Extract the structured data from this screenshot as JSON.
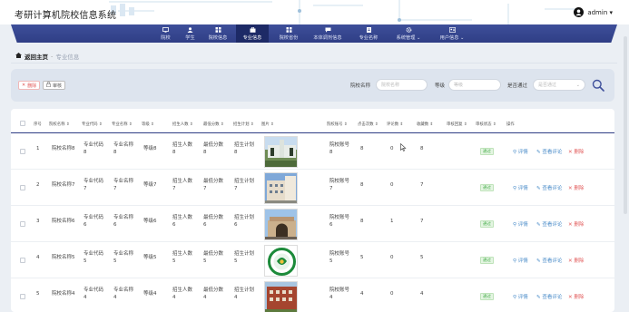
{
  "header": {
    "site_title": "考研计算机院校信息系统",
    "user_name": "admin ▾"
  },
  "nav": {
    "items": [
      {
        "label": "院校",
        "icon": "monitor-icon"
      },
      {
        "label": "学生",
        "icon": "user-icon"
      },
      {
        "label": "院校信息",
        "icon": "grid-icon"
      },
      {
        "label": "专业信息",
        "icon": "briefcase-icon",
        "active": true
      },
      {
        "label": "院校省份",
        "icon": "grid-icon"
      },
      {
        "label": "本体调剂信息",
        "icon": "chat-icon"
      },
      {
        "label": "专业名称",
        "icon": "document-icon"
      },
      {
        "label": "系统管理 ⌄",
        "icon": "gear-icon"
      },
      {
        "label": "用户信息 ⌄",
        "icon": "user-card-icon"
      }
    ]
  },
  "breadcrumb": {
    "home": "返回主页",
    "separator": "-",
    "current": "专业信息"
  },
  "toolbar": {
    "delete_label": "删除",
    "audit_label": "审核",
    "filters": {
      "school_name_label": "院校名称",
      "school_name_placeholder": "院校名称",
      "level_label": "等级",
      "level_placeholder": "等级",
      "passed_label": "是否通过",
      "passed_placeholder": "是否通过"
    }
  },
  "table": {
    "columns": [
      "序号",
      "院校名称 ⇕",
      "专业代码 ⇕",
      "专业名称 ⇕",
      "等级 ⇕",
      "招生人数 ⇕",
      "最低分数 ⇕",
      "招生计划 ⇕",
      "图片 ⇕",
      "院校账号 ⇕",
      "点击次数 ⇕",
      "评论数 ⇕",
      "收藏数 ⇕",
      "审核回复 ⇕",
      "审核状态 ⇕",
      "操作"
    ],
    "rows": [
      {
        "index": "1",
        "school": "院校名称8",
        "code": "专业代码\n8",
        "major": "专业名称\n8",
        "level": "等级8",
        "enroll": "招生人数\n8",
        "min_score": "最低分数\n8",
        "plan": "招生计划\n8",
        "account": "院校账号\n8",
        "clicks": "8",
        "comments": "0",
        "favorites": "8",
        "image": "campus-gate"
      },
      {
        "index": "2",
        "school": "院校名称7",
        "code": "专业代码\n7",
        "major": "专业名称\n7",
        "level": "等级7",
        "enroll": "招生人数\n7",
        "min_score": "最低分数\n7",
        "plan": "招生计划\n7",
        "account": "院校账号\n7",
        "clicks": "8",
        "comments": "0",
        "favorites": "7",
        "image": "campus-building"
      },
      {
        "index": "3",
        "school": "院校名称6",
        "code": "专业代码\n6",
        "major": "专业名称\n6",
        "level": "等级6",
        "enroll": "招生人数\n6",
        "min_score": "最低分数\n6",
        "plan": "招生计划\n6",
        "account": "院校账号\n6",
        "clicks": "8",
        "comments": "1",
        "favorites": "7",
        "image": "arch-gate"
      },
      {
        "index": "4",
        "school": "院校名称5",
        "code": "专业代码\n5",
        "major": "专业名称\n5",
        "level": "等级5",
        "enroll": "招生人数\n5",
        "min_score": "最低分数\n5",
        "plan": "招生计划\n5",
        "account": "院校账号\n5",
        "clicks": "5",
        "comments": "0",
        "favorites": "5",
        "image": "school-emblem"
      },
      {
        "index": "5",
        "school": "院校名称4",
        "code": "专业代码\n4",
        "major": "专业名称\n4",
        "level": "等级4",
        "enroll": "招生人数\n4",
        "min_score": "最低分数\n4",
        "plan": "招生计划\n4",
        "account": "院校账号\n4",
        "clicks": "4",
        "comments": "0",
        "favorites": "4",
        "image": "brick-building"
      }
    ],
    "status_label": "通过",
    "actions": {
      "review": "评情",
      "comments": "查看评论",
      "delete": "删除"
    }
  },
  "colors": {
    "nav_bg": "#2f3e85",
    "nav_active": "#1d2a66",
    "status_green": "#4caf50",
    "link_blue": "#4a8cc9",
    "danger_red": "#e25b5b"
  }
}
